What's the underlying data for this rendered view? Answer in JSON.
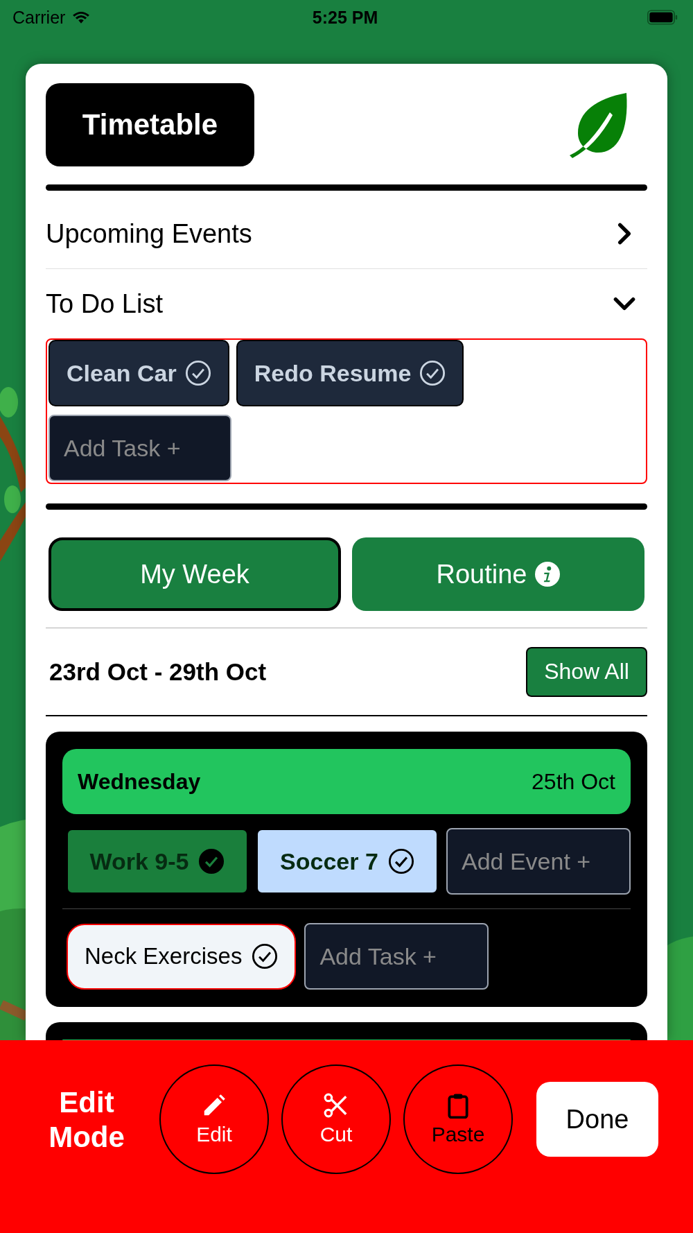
{
  "status_bar": {
    "carrier": "Carrier",
    "time": "5:25 PM"
  },
  "header": {
    "title": "Timetable"
  },
  "sections": [
    {
      "label": "Upcoming Events",
      "expanded": false
    },
    {
      "label": "To Do List",
      "expanded": true
    }
  ],
  "todo": {
    "tasks": [
      {
        "label": "Clean Car"
      },
      {
        "label": "Redo Resume"
      }
    ],
    "add_task": {
      "placeholder": "Add Task +"
    }
  },
  "tabs": [
    {
      "label": "My Week",
      "selected": true,
      "kind": "plain"
    },
    {
      "label": "Routine",
      "selected": false,
      "kind": "info"
    }
  ],
  "week": {
    "range": "23rd Oct - 29th Oct",
    "show_all": "Show All"
  },
  "days": [
    {
      "name": "Wednesday",
      "date": "25th Oct",
      "events": [
        {
          "label": "Work 9-5",
          "color": "#1a7f3c",
          "done": true
        },
        {
          "label": "Soccer 7",
          "color": "#bfdbfe",
          "done": false
        }
      ],
      "add_event": {
        "placeholder": "Add Event +"
      },
      "tasks": [
        {
          "label": "Neck Exercises",
          "selected": true
        }
      ],
      "add_task": {
        "placeholder": "Add Task +"
      }
    }
  ],
  "edit_bar": {
    "title": "Edit Mode",
    "tools": [
      {
        "label": "Edit",
        "kind": "edit",
        "selected": false
      },
      {
        "label": "Cut",
        "kind": "cut",
        "selected": false
      },
      {
        "label": "Paste",
        "kind": "paste",
        "selected": true
      }
    ],
    "done": "Done"
  }
}
